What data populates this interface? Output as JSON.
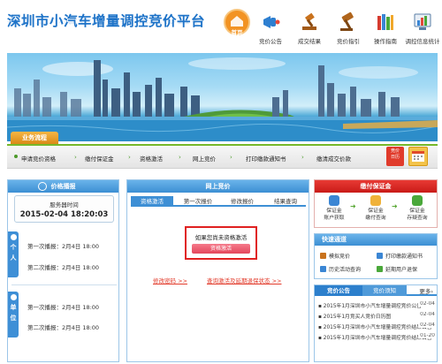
{
  "header": {
    "site_title": "深圳市小汽车增量调控竞价平台",
    "nav": [
      {
        "label": "首页",
        "icon": "home-icon"
      },
      {
        "label": "竞价公告",
        "icon": "megaphone-icon"
      },
      {
        "label": "成交结果",
        "icon": "gavel-hammer-icon"
      },
      {
        "label": "竞价指引",
        "icon": "gavel-icon"
      },
      {
        "label": "操作指南",
        "icon": "books-icon"
      },
      {
        "label": "调控信息统计",
        "icon": "bar-chart-icon"
      }
    ]
  },
  "flow": {
    "tab_label": "业务流程",
    "steps": [
      "申请竞价资格",
      "缴付保证金",
      "资格激活",
      "网上竞价",
      "打印缴款通知书",
      "缴清成交价款"
    ],
    "calendar_label_1": "竞价",
    "calendar_label_2": "日历"
  },
  "price_report": {
    "title": "价格播报",
    "server_time_label": "服务器时间",
    "server_time": "2015-02-04 18:20:03",
    "personal_tab": "个人",
    "unit_tab": "单位",
    "personal_rows": [
      "第一次播报：2月4日 18:00",
      "第二次播报：2月4日 18:00"
    ],
    "unit_rows": [
      "第一次播报：2月4日 18:00",
      "第二次播报：2月4日 18:00"
    ]
  },
  "online_bidding": {
    "title": "网上竞价",
    "tabs": [
      "资格激活",
      "第一次报价",
      "修改报价",
      "结果查询"
    ],
    "notice_text": "如果您尚未资格激活",
    "activate_button": "资格激活",
    "link_change_password": "修改密码 >>",
    "link_query": "查询激活及延期退保状态 >>"
  },
  "deposit": {
    "title": "缴付保证金",
    "items": [
      {
        "line1": "保证金",
        "line2": "账户获取"
      },
      {
        "line1": "保证金",
        "line2": "缴付查询"
      },
      {
        "line1": "保证金",
        "line2": "存疑查询"
      }
    ]
  },
  "quick": {
    "title": "快速通道",
    "items": [
      "模拟竞价",
      "打印缴款通知书",
      "历史活动查询",
      "延期用户退保"
    ]
  },
  "announce": {
    "tabs": [
      "竞价公告",
      "竞价须知"
    ],
    "more": "更多",
    "news": [
      {
        "title": "2015年1月深圳市小汽车增量调控竞价公告",
        "date": "02-04"
      },
      {
        "title": "2015年1月竞买人竞价日历图",
        "date": "02-04"
      },
      {
        "title": "2015年1月深圳市小汽车增量调控竞价结果公告",
        "date": "02-04"
      },
      {
        "title": "2015年1月深圳市小汽车增量调控竞价结果公告",
        "date": "01-20"
      }
    ]
  },
  "colors": {
    "brand_blue": "#1e73c8",
    "accent_orange": "#f29323",
    "alert_red": "#e02020",
    "process_green": "#76b82a"
  }
}
